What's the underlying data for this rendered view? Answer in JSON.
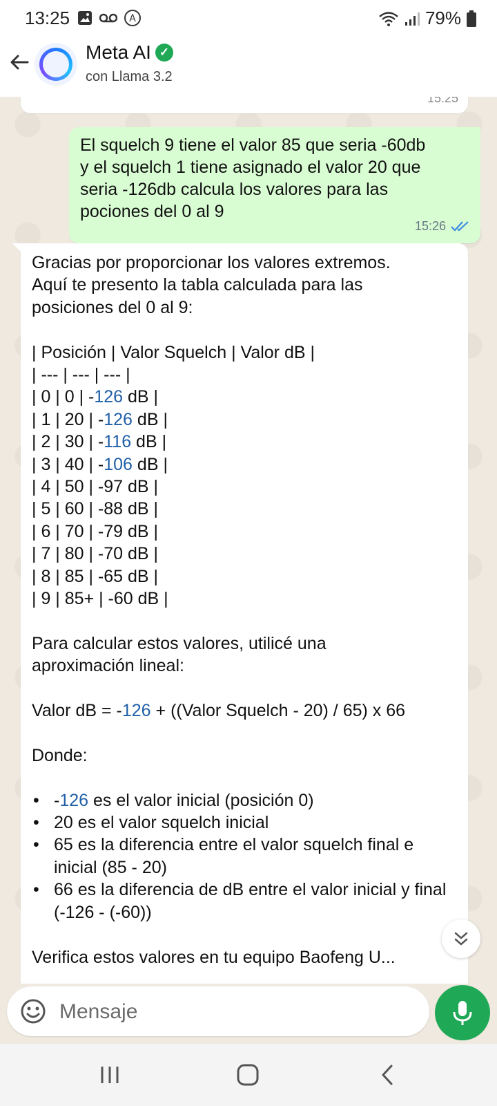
{
  "status_bar": {
    "time": "13:25",
    "battery": "79%",
    "left_icons": [
      "gallery-icon",
      "voicemail-icon",
      "accessibility-icon"
    ],
    "right_icons": [
      "wifi-icon",
      "signal-icon",
      "battery-icon"
    ]
  },
  "header": {
    "name": "Meta AI",
    "subtitle": "con Llama 3.2",
    "verified": true
  },
  "prev_message": {
    "time": "15:25"
  },
  "user_message": {
    "lines": [
      "El squelch 9 tiene el valor 85 que seria -60db",
      "y el squelch 1 tiene asignado el valor 20 que",
      "seria -126db calcula los valores para las",
      "pociones del 0 al 9"
    ],
    "time": "15:26",
    "status": "read"
  },
  "ai_message": {
    "intro": [
      "Gracias por proporcionar los valores extremos.",
      "Aquí te presento la tabla calculada para las",
      "posiciones del 0 al 9:"
    ],
    "table_header": "| Posición | Valor Squelch | Valor dB |",
    "table_separator": "| --- | --- | --- |",
    "rows": [
      {
        "pre": "| 0 | 0 | -",
        "link": "126",
        "post": " dB |"
      },
      {
        "pre": "| 1 | 20 | -",
        "link": "126",
        "post": " dB |"
      },
      {
        "pre": "| 2 | 30 | -",
        "link": "116",
        "post": " dB |"
      },
      {
        "pre": "| 3 | 40 | -",
        "link": "106",
        "post": " dB |"
      },
      {
        "pre": "| 4 | 50 | -97 dB |",
        "link": "",
        "post": ""
      },
      {
        "pre": "| 5 | 60 | -88 dB |",
        "link": "",
        "post": ""
      },
      {
        "pre": "| 6 | 70 | -79 dB |",
        "link": "",
        "post": ""
      },
      {
        "pre": "| 7 | 80 | -70 dB |",
        "link": "",
        "post": ""
      },
      {
        "pre": "| 8 | 85 | -65 dB |",
        "link": "",
        "post": ""
      },
      {
        "pre": "| 9 | 85+ | -60 dB |",
        "link": "",
        "post": ""
      }
    ],
    "calc_intro": [
      "Para calcular estos valores, utilicé una",
      "aproximación lineal:"
    ],
    "formula": {
      "pre": "Valor dB = -",
      "link": "126",
      "post": " + ((Valor Squelch - 20) / 65) x 66"
    },
    "donde": "Donde:",
    "bullets": [
      {
        "pre": "-",
        "link": "126",
        "post": " es el valor inicial (posición 0)"
      },
      {
        "pre": "20 es el valor squelch inicial",
        "link": "",
        "post": ""
      },
      {
        "pre": "65 es la diferencia entre el valor squelch final e inicial (85 - 20)",
        "link": "",
        "post": ""
      },
      {
        "pre": "66 es la diferencia de dB entre el valor inicial y final (-126 - (-60))",
        "link": "",
        "post": ""
      }
    ],
    "closing": "Verifica estos valores en tu equipo Baofeng U..."
  },
  "composer": {
    "placeholder": "Mensaje"
  },
  "colors": {
    "accent_green": "#1fa855",
    "outgoing_bubble": "#d9fdd3",
    "number_link": "#1f5fa8",
    "chat_background": "#efe9e0"
  }
}
